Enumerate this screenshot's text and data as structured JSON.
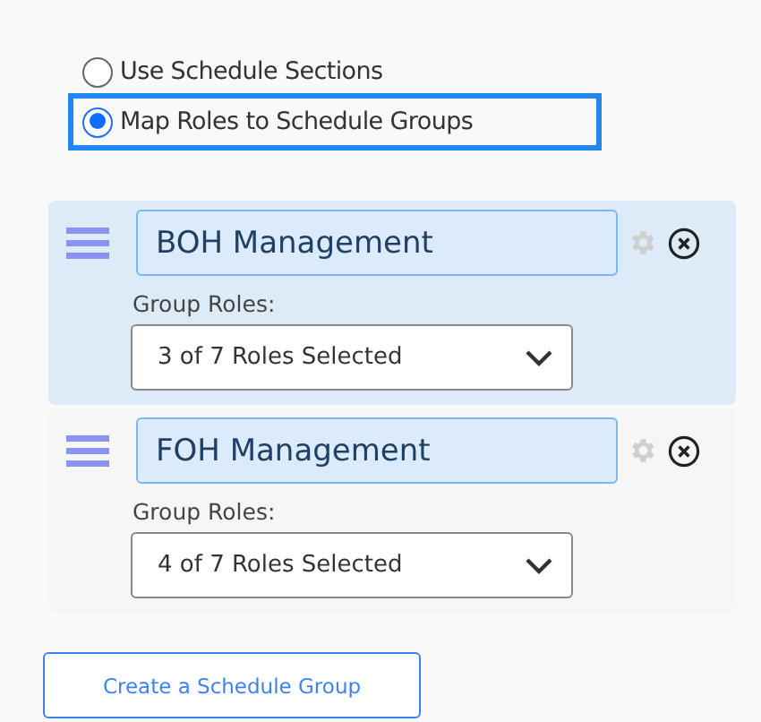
{
  "mode_options": [
    {
      "label": "Use Schedule Sections",
      "selected": false
    },
    {
      "label": "Map Roles to Schedule Groups",
      "selected": true
    }
  ],
  "groups": [
    {
      "name": "BOH Management",
      "selected": true,
      "roles_label": "Group Roles:",
      "roles_value": "3 of 7 Roles Selected"
    },
    {
      "name": "FOH Management",
      "selected": false,
      "roles_label": "Group Roles:",
      "roles_value": "4 of 7 Roles Selected"
    }
  ],
  "create_button": "Create a Schedule Group"
}
